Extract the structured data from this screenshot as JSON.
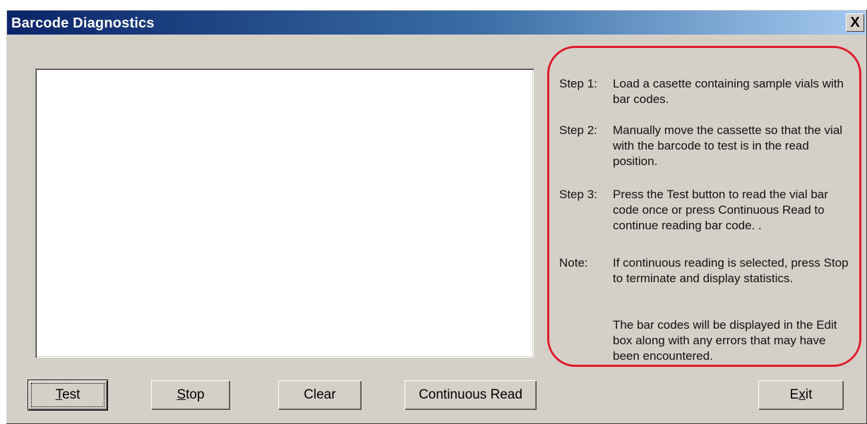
{
  "window": {
    "title": "Barcode Diagnostics",
    "close_glyph": "X"
  },
  "edit_box": {
    "value": ""
  },
  "instructions": {
    "steps": [
      {
        "label": "Step 1:",
        "text": "Load a casette containing sample vials with bar codes."
      },
      {
        "label": "Step 2:",
        "text": "Manually move the cassette so that the vial with the barcode to test is in the read position."
      },
      {
        "label": "Step 3:",
        "text": "Press the Test button to read the vial bar code once or press Continuous Read to continue reading bar code. ."
      },
      {
        "label": "Note:",
        "text": "If continuous reading is selected, press Stop to terminate and display statistics."
      },
      {
        "label": "",
        "text": "The bar codes will be displayed in the Edit box along with any errors that may have been encountered."
      }
    ],
    "highlight_color": "#e01a2b"
  },
  "buttons": {
    "test": {
      "mnemonic": "T",
      "rest": "est"
    },
    "stop": {
      "mnemonic": "S",
      "rest": "top"
    },
    "clear": {
      "label": "Clear"
    },
    "continuous_read": {
      "label": "Continuous Read"
    },
    "exit": {
      "pre": "E",
      "mnemonic": "x",
      "rest": "it"
    }
  }
}
